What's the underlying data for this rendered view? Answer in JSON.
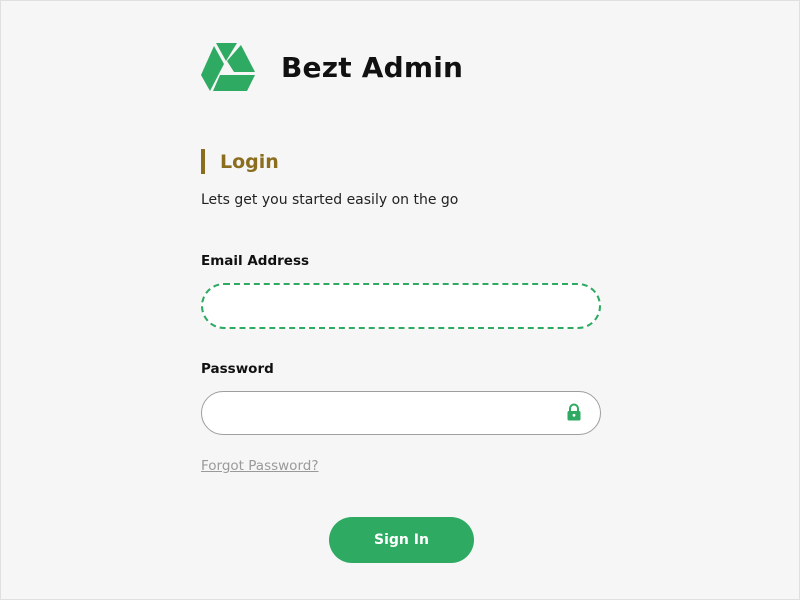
{
  "brand": {
    "name": "Bezt Admin",
    "logo_icon": "triangle-logo-icon",
    "color": "#2eaa62"
  },
  "login": {
    "title": "Login",
    "subtitle": "Lets get you started easily on the go",
    "title_accent": "#8a6d1f"
  },
  "form": {
    "email_label": "Email Address",
    "email_value": "",
    "email_placeholder": "",
    "password_label": "Password",
    "password_value": "",
    "password_placeholder": "",
    "password_icon": "lock-icon",
    "forgot_label": "Forgot Password?",
    "signin_label": "Sign In"
  },
  "colors": {
    "primary": "#2eaa62",
    "accent": "#8a6d1f",
    "muted_link": "#9a9a9a",
    "background": "#f6f6f6"
  }
}
